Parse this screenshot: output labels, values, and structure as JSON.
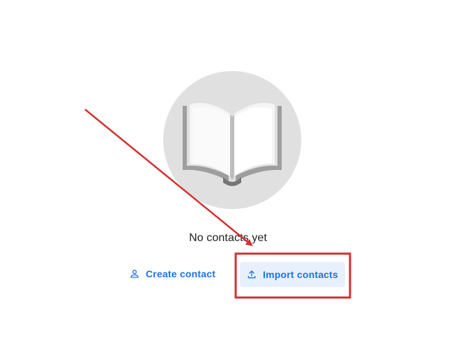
{
  "empty_state": {
    "title": "No contacts yet",
    "illustration_icon": "open-book-icon"
  },
  "actions": {
    "create": {
      "label": "Create contact",
      "icon": "person-outline-icon"
    },
    "import": {
      "label": "Import contacts",
      "icon": "upload-icon"
    }
  },
  "colors": {
    "accent": "#1a73e8",
    "import_background": "#e8f0fe",
    "illustration_circle": "#e0e0e0",
    "annotation": "#d32f2f"
  }
}
